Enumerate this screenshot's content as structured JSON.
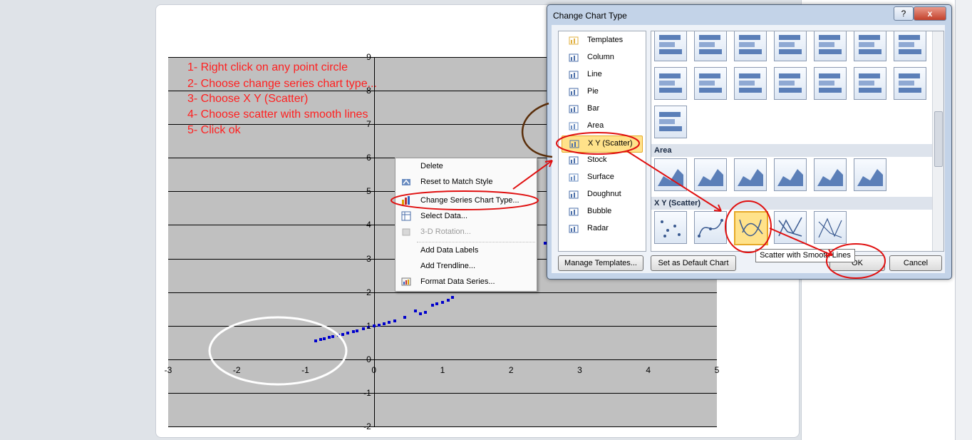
{
  "instructions": [
    "1- Right click on any point circle",
    "2- Choose change series chart type...",
    "3- Choose X Y (Scatter)",
    "4- Choose scatter with smooth lines",
    "5- Click ok"
  ],
  "context_menu": {
    "items": [
      {
        "label": "Delete",
        "enabled": true
      },
      {
        "label": "Reset to Match Style",
        "enabled": true
      },
      {
        "label": "Change Series Chart Type...",
        "enabled": true
      },
      {
        "label": "Select Data...",
        "enabled": true
      },
      {
        "label": "3-D Rotation...",
        "enabled": false
      },
      {
        "label": "Add Data Labels",
        "enabled": true
      },
      {
        "label": "Add Trendline...",
        "enabled": true
      },
      {
        "label": "Format Data Series...",
        "enabled": true
      }
    ]
  },
  "dialog": {
    "title": "Change Chart Type",
    "help_label": "?",
    "close_label": "x",
    "chart_types": [
      "Templates",
      "Column",
      "Line",
      "Pie",
      "Bar",
      "Area",
      "X Y (Scatter)",
      "Stock",
      "Surface",
      "Doughnut",
      "Bubble",
      "Radar"
    ],
    "selected_type": "X Y (Scatter)",
    "sections": {
      "area": "Area",
      "scatter": "X Y (Scatter)"
    },
    "buttons": {
      "manage_templates": "Manage Templates...",
      "set_default": "Set as Default Chart",
      "ok": "OK",
      "cancel": "Cancel"
    },
    "tooltip": "Scatter with Smooth Lines"
  },
  "annotation_colors": {
    "red": "#e01010",
    "white": "#ffffff",
    "brown": "#5a2e0a"
  },
  "chart_data": {
    "type": "scatter",
    "xlim": [
      -3,
      5
    ],
    "ylim": [
      -2,
      9
    ],
    "x_ticks": [
      -3,
      -2,
      -1,
      0,
      1,
      2,
      3,
      4,
      5
    ],
    "y_ticks": [
      -2,
      -1,
      0,
      1,
      2,
      3,
      4,
      5,
      6,
      7,
      8,
      9
    ],
    "grid": true,
    "series": [
      {
        "color": "#0000cc",
        "points": [
          [
            -0.85,
            0.55
          ],
          [
            -0.78,
            0.6
          ],
          [
            -0.72,
            0.62
          ],
          [
            -0.65,
            0.66
          ],
          [
            -0.6,
            0.68
          ],
          [
            -0.52,
            0.72
          ],
          [
            -0.45,
            0.75
          ],
          [
            -0.38,
            0.78
          ],
          [
            -0.3,
            0.82
          ],
          [
            -0.25,
            0.85
          ],
          [
            -0.15,
            0.9
          ],
          [
            -0.08,
            0.95
          ],
          [
            0.0,
            1.0
          ],
          [
            0.08,
            1.02
          ],
          [
            0.15,
            1.05
          ],
          [
            0.22,
            1.1
          ],
          [
            0.3,
            1.15
          ],
          [
            0.45,
            1.25
          ],
          [
            0.6,
            1.45
          ],
          [
            0.68,
            1.35
          ],
          [
            0.75,
            1.4
          ],
          [
            0.85,
            1.6
          ],
          [
            0.92,
            1.65
          ],
          [
            1.0,
            1.7
          ],
          [
            1.08,
            1.75
          ],
          [
            1.15,
            1.85
          ],
          [
            2.5,
            3.45
          ],
          [
            2.55,
            3.8
          ],
          [
            2.6,
            3.9
          ]
        ]
      }
    ]
  }
}
